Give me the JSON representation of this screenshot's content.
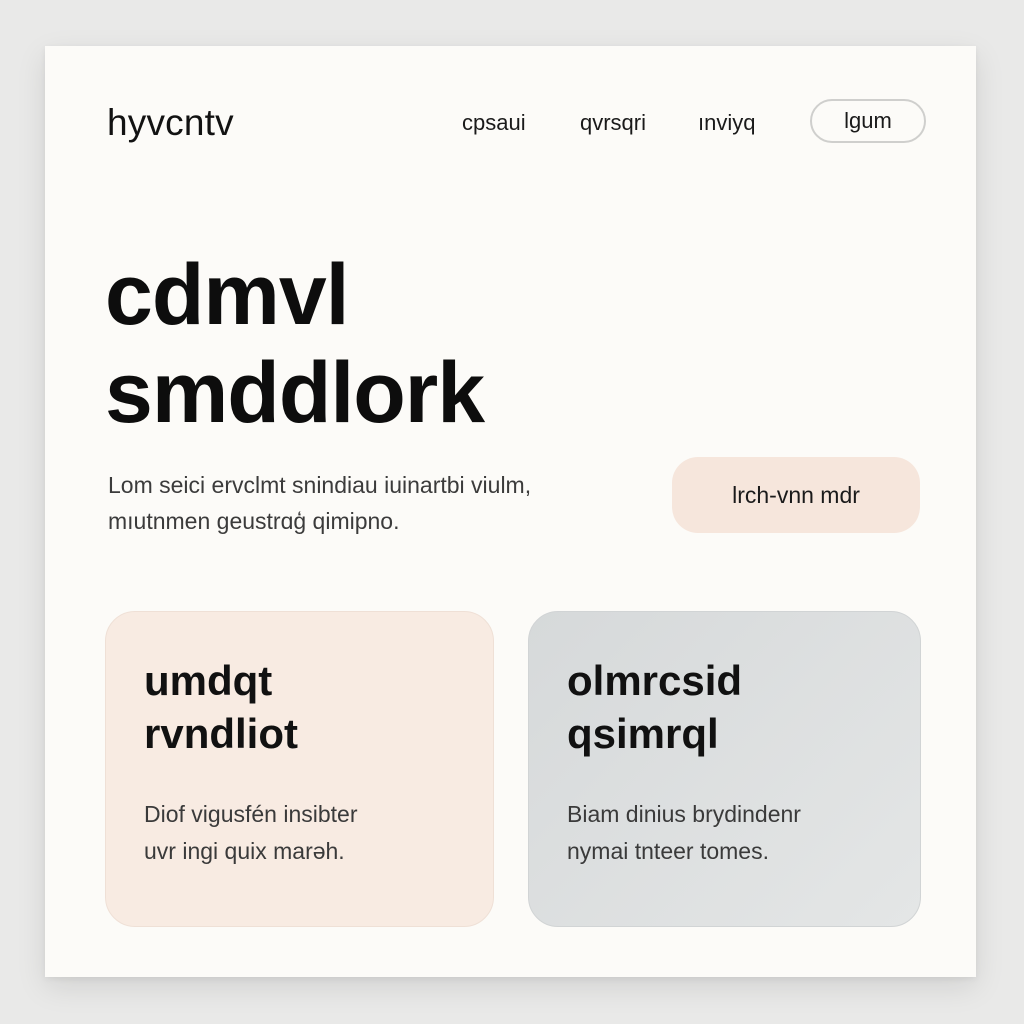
{
  "header": {
    "logo": "hyvcntv",
    "nav": [
      "cpsaui",
      "qvrsqri",
      "ınviyq"
    ],
    "login_label": "lgum"
  },
  "hero": {
    "title_lines": [
      "cdmvl",
      "smddlork"
    ],
    "text_lines": [
      "Lom seici ervclmt snindiau iuinartbi viulm,",
      "mıutnmen geustrɑģ qimipno."
    ],
    "cta_label": "lrch-vnn mdr"
  },
  "cards": [
    {
      "title_lines": [
        "umdqt",
        "rvndliot"
      ],
      "text_lines": [
        "Diof vigusfén insibter",
        "uvr ingi quix marəh."
      ],
      "background": "#f8ebe2"
    },
    {
      "title_lines": [
        "olmrcsid",
        "qsimrql"
      ],
      "text_lines": [
        "Biam dinius brydindenr",
        "nymai tnteer tomes."
      ],
      "background": "#dcdfe0"
    }
  ],
  "colors": {
    "page_bg": "#fcfbf8",
    "accent": "#f6e6dc",
    "text": "#121212"
  }
}
